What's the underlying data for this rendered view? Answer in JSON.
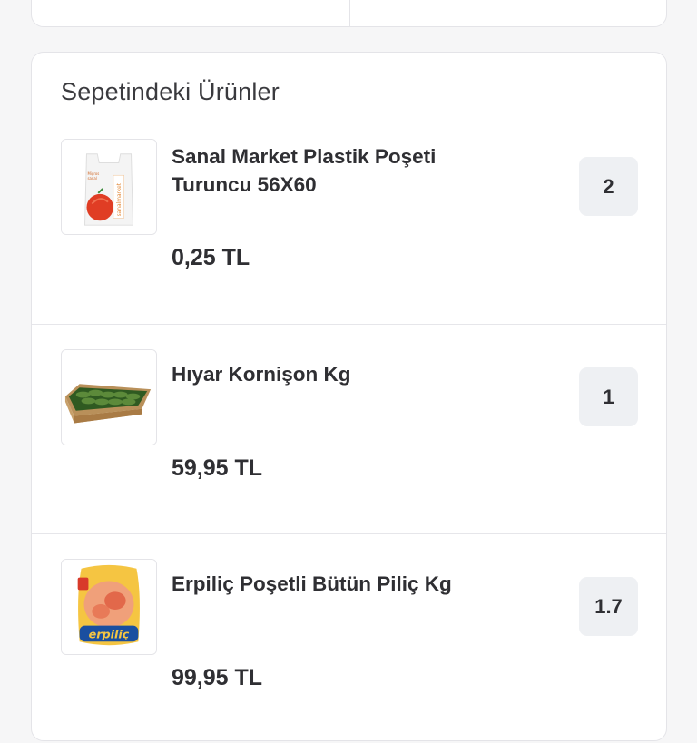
{
  "basket": {
    "title": "Sepetindeki Ürünler",
    "items": [
      {
        "name_line1": "Sanal Market Plastik Poşeti",
        "name_line2": "Turuncu 56X60",
        "price": "0,25 TL",
        "quantity": "2",
        "image_icon": "plastic-bag-icon"
      },
      {
        "name": "Hıyar Kornişon  Kg",
        "price": "59,95 TL",
        "quantity": "1",
        "image_icon": "pickled-cucumber-crate-icon"
      },
      {
        "name": "Erpiliç Poşetli Bütün Piliç Kg",
        "price": "99,95 TL",
        "quantity": "1.7",
        "image_icon": "whole-chicken-package-icon"
      }
    ]
  }
}
